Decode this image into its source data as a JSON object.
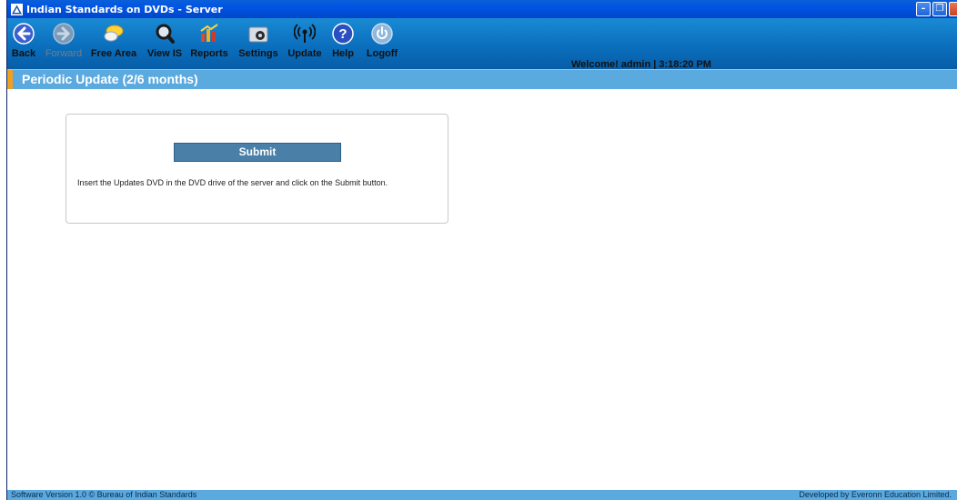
{
  "window": {
    "title": "Indian Standards on DVDs - Server",
    "controls": [
      "minimize",
      "restore",
      "close"
    ]
  },
  "toolbar": {
    "items": [
      {
        "label": "Back",
        "icon": "back-arrow-icon",
        "enabled": true
      },
      {
        "label": "Forward",
        "icon": "forward-arrow-icon",
        "enabled": false
      },
      {
        "label": "Free Area",
        "icon": "chat-bubble-icon",
        "enabled": true
      },
      {
        "label": "View IS",
        "icon": "magnifier-icon",
        "enabled": true
      },
      {
        "label": "Reports",
        "icon": "reports-icon",
        "enabled": true
      },
      {
        "label": "Settings",
        "icon": "settings-icon",
        "enabled": true
      },
      {
        "label": "Update",
        "icon": "broadcast-icon",
        "enabled": true
      },
      {
        "label": "Help",
        "icon": "help-icon",
        "enabled": true
      },
      {
        "label": "Logoff",
        "icon": "power-icon",
        "enabled": true
      }
    ]
  },
  "status": {
    "welcome_text": "Welcome!  admin  | 3:18:20 PM"
  },
  "section": {
    "title": "Periodic Update (2/6 months)"
  },
  "panel": {
    "submit_label": "Submit",
    "instruction": "Insert the Updates DVD in the DVD drive of the server and click on the Submit button."
  },
  "footer": {
    "left": "Software Version 1.0   © Bureau of Indian Standards",
    "right": "Developed by Everonn Education Limited."
  },
  "colors": {
    "titlebar": "#0054e3",
    "toolbar": "#0b6fbd",
    "section_header": "#5aa9df",
    "submit_button": "#4a7fa8",
    "footer": "#5aa9df"
  }
}
